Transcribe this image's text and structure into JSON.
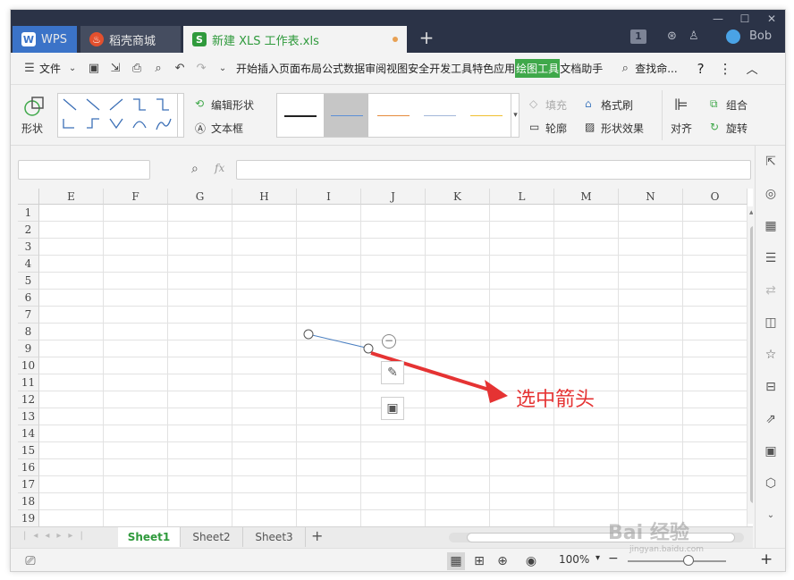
{
  "titlebar": {
    "tabs": [
      {
        "label": "WPS",
        "icon": "wps-logo-icon"
      },
      {
        "label": "稻壳商城",
        "icon": "flame-icon"
      },
      {
        "label": "新建 XLS 工作表.xls",
        "icon": "sheet-doc-icon"
      }
    ],
    "badge": "1",
    "user": "Bob",
    "colors": {
      "bar": "#2b3347",
      "active_tab": "#f3f3f3",
      "wps_tab": "#3b73c8",
      "unsaved_dot": "#e8a154"
    }
  },
  "menubar": {
    "file_label": "文件",
    "items": [
      "开始",
      "插入",
      "页面布局",
      "公式",
      "数据",
      "审阅",
      "视图",
      "安全",
      "开发工具",
      "特色应用",
      "绘图工具",
      "文档助手"
    ],
    "active_item": "绘图工具",
    "search_label": "查找命...",
    "help": "?",
    "accent": "#3fa84a"
  },
  "ribbon": {
    "shape_label": "形状",
    "edit_shape": "编辑形状",
    "text_box": "文本框",
    "fill": "填充",
    "format_brush": "格式刷",
    "outline": "轮廓",
    "shape_effect": "形状效果",
    "align": "对齐",
    "group": "组合",
    "rotate": "旋转",
    "line_colors": [
      "#222222",
      "#5b8fd6",
      "#e68a3c",
      "#a3b7d9",
      "#f0c030"
    ]
  },
  "formula": {
    "fx": "fx",
    "name_value": "",
    "formula_value": ""
  },
  "grid": {
    "columns": [
      "E",
      "F",
      "G",
      "H",
      "I",
      "J",
      "K",
      "L",
      "M",
      "N",
      "O"
    ],
    "rows": [
      "1",
      "2",
      "3",
      "4",
      "5",
      "6",
      "7",
      "8",
      "9",
      "10",
      "11",
      "12",
      "13",
      "14",
      "15",
      "16",
      "17",
      "18",
      "19"
    ]
  },
  "annotation": {
    "text": "选中箭头",
    "color": "#e53333"
  },
  "sheets": {
    "tabs": [
      "Sheet1",
      "Sheet2",
      "Sheet3"
    ],
    "active": "Sheet1",
    "add": "+"
  },
  "status": {
    "zoom": "100%"
  },
  "watermark": {
    "brand": "Bai 经验",
    "url": "jingyan.baidu.com"
  }
}
